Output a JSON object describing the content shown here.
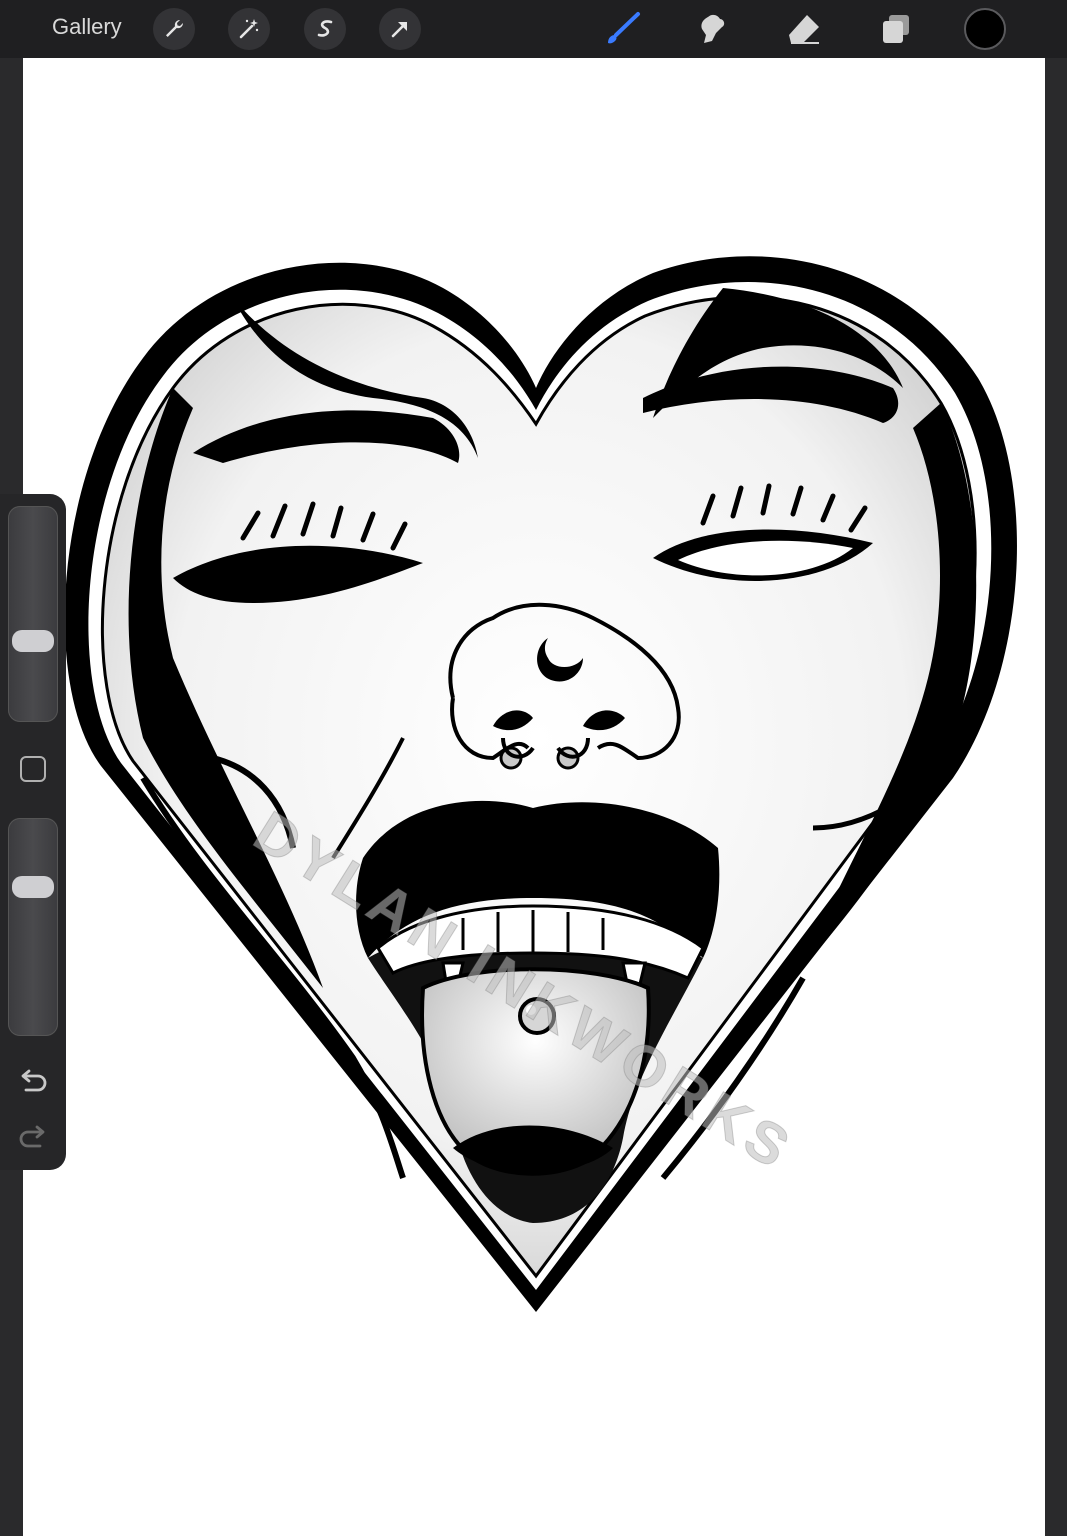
{
  "toolbar": {
    "gallery_label": "Gallery",
    "left_tools": [
      "wrench-icon",
      "magic-wand-icon",
      "selection-icon",
      "transform-arrow-icon"
    ],
    "right_tools": [
      "brush-icon",
      "smudge-icon",
      "eraser-icon",
      "layers-icon"
    ],
    "active_tool": "brush-icon",
    "active_tool_color": "#3a7bff",
    "current_color": "#000000"
  },
  "sidebar": {
    "brush_size_level": 0.35,
    "opacity_level": 0.72,
    "controls": [
      "modify-button",
      "undo-icon",
      "redo-icon"
    ]
  },
  "canvas": {
    "background": "#ffffff",
    "artwork": "heart-face-illustration",
    "watermark_text": "DYLAN INKWORKS"
  }
}
